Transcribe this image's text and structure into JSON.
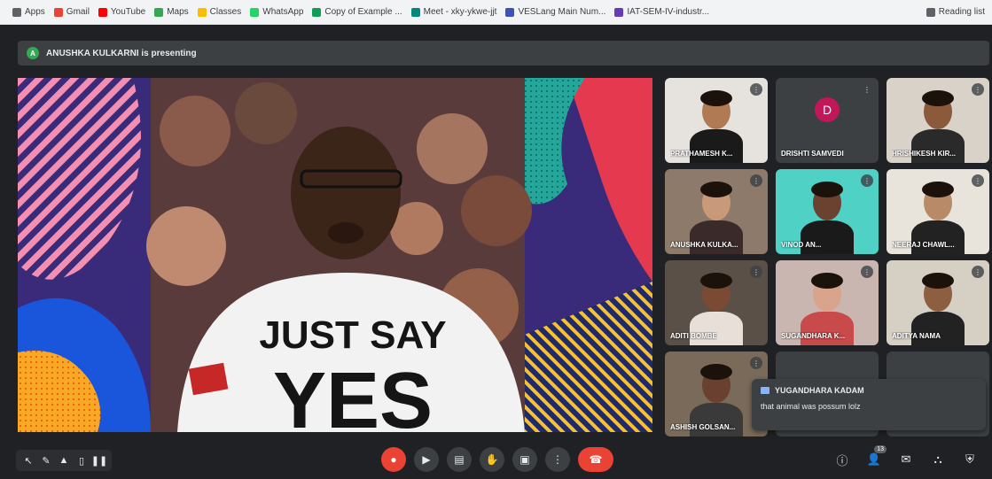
{
  "bookmarks": [
    {
      "label": "Apps",
      "color": "#5f6368"
    },
    {
      "label": "Gmail",
      "color": "#ea4335"
    },
    {
      "label": "YouTube",
      "color": "#ff0000"
    },
    {
      "label": "Maps",
      "color": "#34a853"
    },
    {
      "label": "Classes",
      "color": "#fbbc04"
    },
    {
      "label": "WhatsApp",
      "color": "#25d366"
    },
    {
      "label": "Copy of Example ...",
      "color": "#0f9d58"
    },
    {
      "label": "Meet - xky-ykwe-jjt",
      "color": "#00897b"
    },
    {
      "label": "VESLang Main Num...",
      "color": "#3f51b5"
    },
    {
      "label": "IAT-SEM-IV-industr...",
      "color": "#673ab7"
    }
  ],
  "reading_list": "Reading list",
  "banner": {
    "avatar_letter": "A",
    "text": "ANUSHKA KULKARNI is presenting"
  },
  "presentation": {
    "shirt_line1": "JUST SAY",
    "shirt_line2": "YES"
  },
  "participants": [
    {
      "name": "PRATHAMESH K...",
      "bg": "#e6e2dd",
      "skin": "#b07a55",
      "shirt": "#1a1a1a"
    },
    {
      "name": "DRISHTI SAMVEDI",
      "bg": "#3c4043",
      "letter": "D"
    },
    {
      "name": "HRISHIKESH KIR...",
      "bg": "#d9d2c8",
      "skin": "#8a5a3a",
      "shirt": "#2a2a2a"
    },
    {
      "name": "ANUSHKA KULKA...",
      "bg": "#8d7a6a",
      "skin": "#c89a7a",
      "shirt": "#3a2a2a"
    },
    {
      "name": "VINOD AN...",
      "bg": "#4fd1c5",
      "skin": "#6b4230",
      "shirt": "#1a1a1a"
    },
    {
      "name": "NEERAJ CHAWL...",
      "bg": "#e8e4dc",
      "skin": "#b98a66",
      "shirt": "#222222"
    },
    {
      "name": "ADITI BOMBE",
      "bg": "#5b5048",
      "skin": "#7a4a35",
      "shirt": "#e8e0d8"
    },
    {
      "name": "SUGANDHARA K...",
      "bg": "#c9b6b0",
      "skin": "#d8a48c",
      "shirt": "#c94a4a"
    },
    {
      "name": "ADITYA NAMA",
      "bg": "#d6cfc4",
      "skin": "#8e5e40",
      "shirt": "#222222"
    },
    {
      "name": "ASHISH GOLSAN...",
      "bg": "#7a6a5a",
      "skin": "#6a4030",
      "shirt": "#3a3a3a"
    },
    {
      "name": "",
      "bg": "#3c4043"
    },
    {
      "name": "",
      "bg": "#3c4043"
    }
  ],
  "chat": {
    "sender": "YUGANDHARA KADAM",
    "message": "that animal was possum lolz"
  },
  "controls": {
    "participant_count": "13"
  }
}
